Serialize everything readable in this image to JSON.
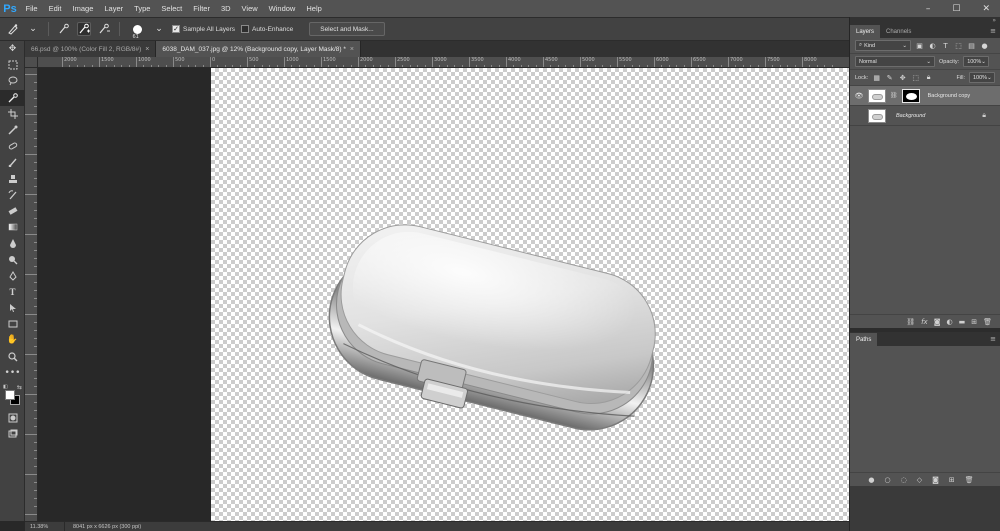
{
  "app": {
    "logo": "Ps",
    "menu": [
      "File",
      "Edit",
      "Image",
      "Layer",
      "Type",
      "Select",
      "Filter",
      "3D",
      "View",
      "Window",
      "Help"
    ],
    "window_controls": [
      "–",
      "☐",
      "✕"
    ]
  },
  "options_bar": {
    "brush_size": "61",
    "sample_all_layers_label": "Sample All Layers",
    "sample_all_layers_checked": true,
    "auto_enhance_label": "Auto-Enhance",
    "auto_enhance_checked": false,
    "select_and_mask_label": "Select and Mask..."
  },
  "tabs": [
    {
      "label": "66.psd @ 100% (Color Fill 2, RGB/8#)",
      "active": false,
      "close": "×"
    },
    {
      "label": "6038_DAM_037.jpg @ 12% (Background copy, Layer Mask/8) *",
      "active": true,
      "close": "×"
    }
  ],
  "ruler": {
    "labels": [
      "2000",
      "1500",
      "1000",
      "500",
      "0",
      "500",
      "1000",
      "1500",
      "2000",
      "2500",
      "3000",
      "3500",
      "4000",
      "4500",
      "5000",
      "5500",
      "6000",
      "6500",
      "7000",
      "7500",
      "8000"
    ]
  },
  "status": {
    "zoom": "11.38%",
    "info": "8041 px x 6626 px (300 ppi)"
  },
  "layers_panel": {
    "tabs": [
      "Layers",
      "Channels"
    ],
    "kind_label": "Kind",
    "blend_mode": "Normal",
    "opacity_label": "Opacity:",
    "opacity_value": "100%",
    "lock_label": "Lock:",
    "fill_label": "Fill:",
    "fill_value": "100%",
    "layers": [
      {
        "name": "Background copy",
        "visible": true,
        "selected": true,
        "has_mask": true
      },
      {
        "name": "Background",
        "visible": false,
        "selected": false,
        "locked": true
      }
    ]
  },
  "paths_panel": {
    "title": "Paths"
  },
  "colors": {
    "menubar": "#535353",
    "panel": "#535353",
    "workspace": "#282828",
    "ps_blue": "#31a8ff"
  }
}
